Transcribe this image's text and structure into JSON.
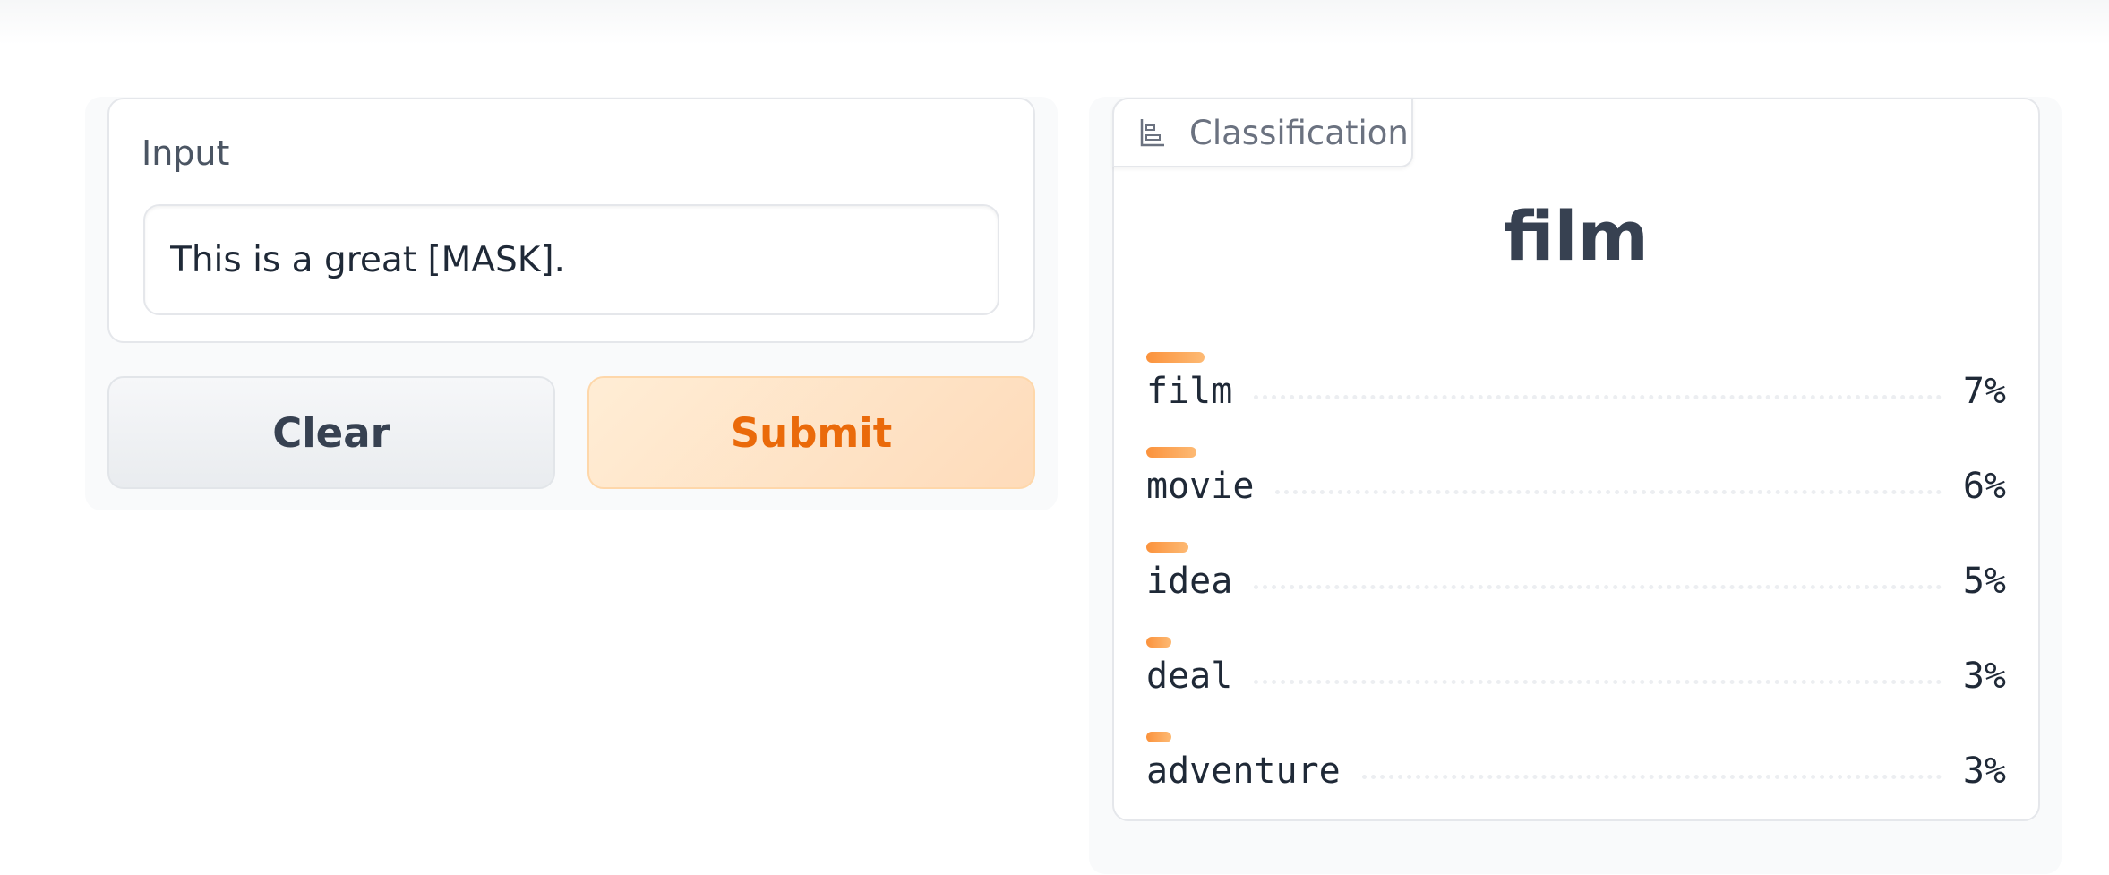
{
  "input": {
    "label": "Input",
    "value": "This is a great [MASK]."
  },
  "buttons": {
    "clear": "Clear",
    "submit": "Submit"
  },
  "output": {
    "tab_label": "Classification",
    "tab_icon": "bar-chart-icon",
    "top_label": "film",
    "confidences": [
      {
        "label": "film",
        "pct": "7%",
        "value": 0.07
      },
      {
        "label": "movie",
        "pct": "6%",
        "value": 0.06
      },
      {
        "label": "idea",
        "pct": "5%",
        "value": 0.05
      },
      {
        "label": "deal",
        "pct": "3%",
        "value": 0.03
      },
      {
        "label": "adventure",
        "pct": "3%",
        "value": 0.03
      }
    ]
  },
  "colors": {
    "accent": "#ea6a0a",
    "bar": "#fb923c"
  }
}
